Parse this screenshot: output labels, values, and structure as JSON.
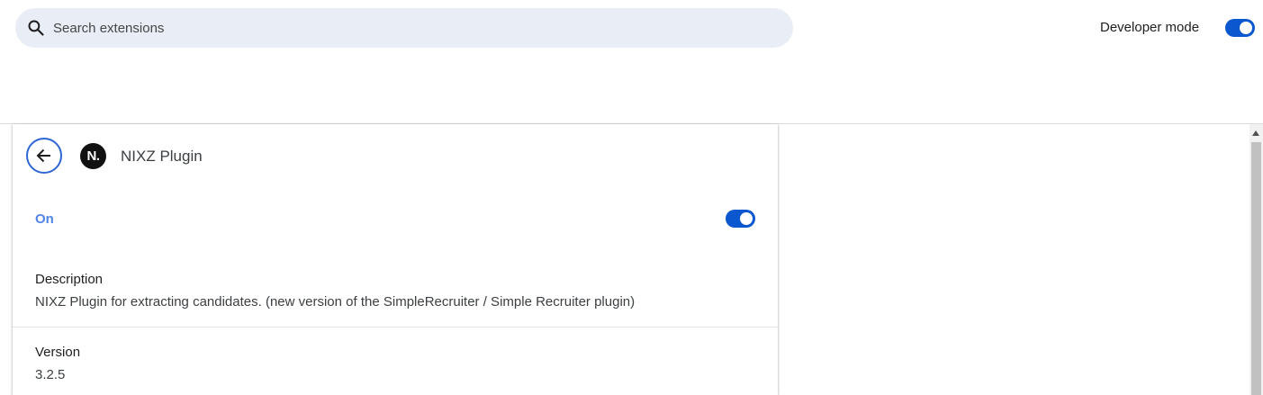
{
  "header": {
    "search": {
      "placeholder": "Search extensions",
      "value": "",
      "icon": "search-icon"
    },
    "developer_mode": {
      "label": "Developer mode",
      "enabled": true
    }
  },
  "detail": {
    "back_icon": "arrow-left-icon",
    "extension": {
      "logo_text": "N.",
      "name": "NIXZ Plugin"
    },
    "status": {
      "label": "On",
      "enabled": true
    },
    "description": {
      "title": "Description",
      "value": "NIXZ Plugin for extracting candidates. (new version of the SimpleRecruiter / Simple Recruiter plugin)"
    },
    "version": {
      "title": "Version",
      "value": "3.2.5"
    }
  },
  "colors": {
    "accent": "#0b57d0",
    "on_label": "#4f84e8",
    "search_bg": "#e9eef6"
  }
}
